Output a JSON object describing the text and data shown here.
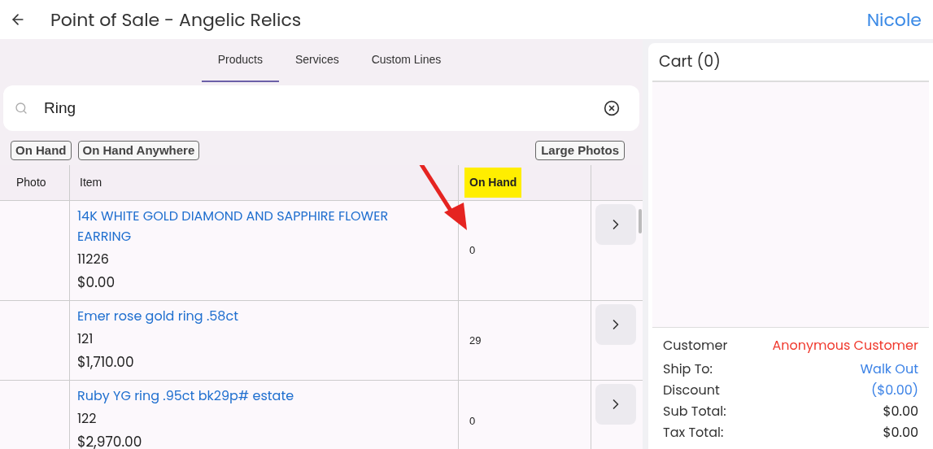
{
  "header": {
    "title": "Point of Sale - Angelic Relics",
    "user": "Nicole"
  },
  "tabs": [
    {
      "label": "Products",
      "selected": true
    },
    {
      "label": "Services",
      "selected": false
    },
    {
      "label": "Custom Lines",
      "selected": false
    }
  ],
  "search": {
    "value": "Ring"
  },
  "filters": [
    {
      "label": "On Hand"
    },
    {
      "label": "On Hand Anywhere"
    }
  ],
  "view_toggle": {
    "label": "Large Photos"
  },
  "table": {
    "columns": [
      "Photo",
      "Item",
      "On Hand"
    ],
    "rows": [
      {
        "name": "14K WHITE GOLD DIAMOND AND SAPPHIRE FLOWER EARRING",
        "sku": "11226",
        "price": "$0.00",
        "on_hand": "0"
      },
      {
        "name": "Emer rose gold ring .58ct",
        "sku": "121",
        "price": "$1,710.00",
        "on_hand": "29"
      },
      {
        "name": "Ruby YG ring .95ct bk29p# estate",
        "sku": "122",
        "price": "$2,970.00",
        "on_hand": "0"
      }
    ]
  },
  "cart": {
    "title": "Cart (0)",
    "summary": [
      {
        "label": "Customer",
        "value": "Anonymous Customer",
        "kind": "alert"
      },
      {
        "label": "Ship To:",
        "value": "Walk Out",
        "kind": "link"
      },
      {
        "label": "Discount",
        "value": "($0.00)",
        "kind": "link"
      },
      {
        "label": "Sub Total:",
        "value": "$0.00",
        "kind": "plain"
      },
      {
        "label": "Tax Total:",
        "value": "$0.00",
        "kind": "plain"
      }
    ]
  }
}
